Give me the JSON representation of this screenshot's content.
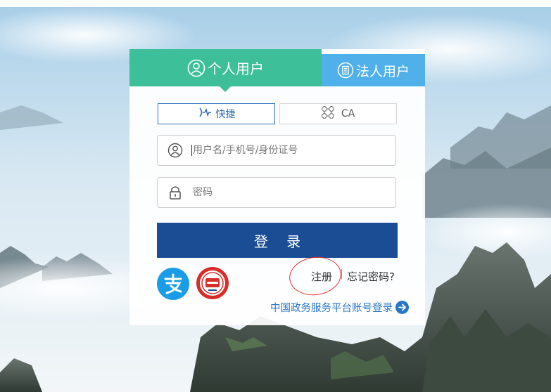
{
  "tabs": {
    "personal": "个人用户",
    "legal": "法人用户"
  },
  "login_modes": {
    "quick": "快捷",
    "ca": "CA"
  },
  "fields": {
    "username_placeholder": "用户名/手机号/身份证号",
    "password_placeholder": "密码"
  },
  "login_button": "登 录",
  "links": {
    "register": "注册",
    "separator": "|",
    "forgot": "忘记密码?",
    "gov_login": "中国政务服务平台账号登录"
  },
  "icons": [
    "user-icon",
    "building-icon",
    "quick-login-icon",
    "ca-icon",
    "lock-icon",
    "alipay-icon",
    "social-security-card-icon",
    "arrow-right-icon"
  ],
  "colors": {
    "personal_tab": "#3dbf9a",
    "legal_tab": "#4fb0ea",
    "login_button": "#1b4d94",
    "link": "#2a76c6",
    "annotation_circle": "#e0302a"
  }
}
